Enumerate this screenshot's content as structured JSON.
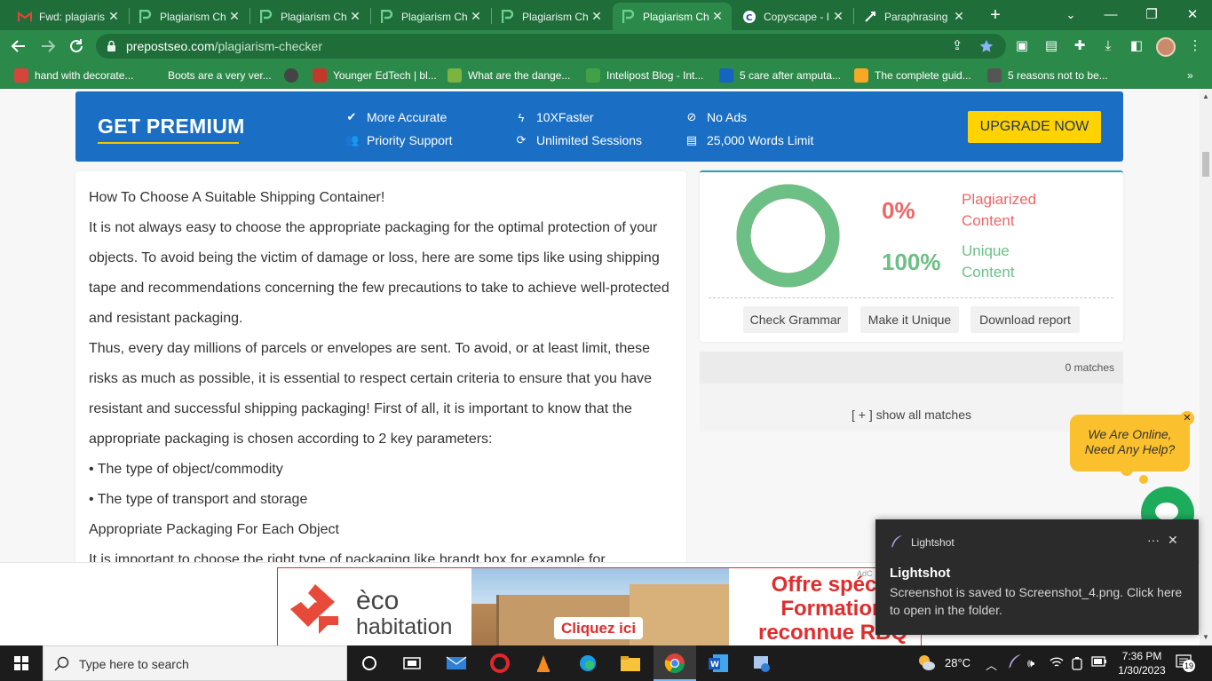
{
  "browser": {
    "tabs": [
      {
        "title": "Fwd: plagiaris",
        "icon": "gmail-icon",
        "active": false
      },
      {
        "title": "Plagiarism Ch",
        "icon": "prepostseo-icon",
        "active": false
      },
      {
        "title": "Plagiarism Ch",
        "icon": "prepostseo-icon",
        "active": false
      },
      {
        "title": "Plagiarism Ch",
        "icon": "prepostseo-icon",
        "active": false
      },
      {
        "title": "Plagiarism Ch",
        "icon": "prepostseo-icon",
        "active": false
      },
      {
        "title": "Plagiarism Ch",
        "icon": "prepostseo-icon",
        "active": true
      },
      {
        "title": "Copyscape - I",
        "icon": "copyscape-icon",
        "active": false
      },
      {
        "title": "Paraphrasing",
        "icon": "paraphrasing-icon",
        "active": false
      }
    ],
    "tab_close": "✕",
    "new_tab": "+",
    "window_controls": {
      "minimize": "—",
      "restore": "❐",
      "close": "✕",
      "tab_search": "⌄"
    },
    "url_domain": "prepostseo.com",
    "url_path": "/plagiarism-checker",
    "bookmarks": [
      {
        "label": "hand with decorate...",
        "icon_color": "#d6453b"
      },
      {
        "label": "Boots are a very ver...",
        "icon_color": "#2b8a4a"
      },
      {
        "label": "",
        "icon_color": "#444444"
      },
      {
        "label": "Younger EdTech | bl...",
        "icon_color": "#c0392b"
      },
      {
        "label": "What are the dange...",
        "icon_color": "#7cb342"
      },
      {
        "label": "Intelipost Blog - Int...",
        "icon_color": "#43a047"
      },
      {
        "label": "5 care after amputa...",
        "icon_color": "#1565c0"
      },
      {
        "label": "The complete guid...",
        "icon_color": "#f9a825"
      },
      {
        "label": "5 reasons not to be...",
        "icon_color": "#555555"
      }
    ],
    "bookmarks_overflow": "»"
  },
  "premium": {
    "title": "GET PREMIUM",
    "features": [
      {
        "label": "More Accurate",
        "icon": "check-circle-icon"
      },
      {
        "label": "Priority Support",
        "icon": "users-icon"
      },
      {
        "label": "10XFaster",
        "icon": "bolt-icon"
      },
      {
        "label": "Unlimited Sessions",
        "icon": "refresh-icon"
      },
      {
        "label": "No Ads",
        "icon": "ban-icon"
      },
      {
        "label": "25,000 Words Limit",
        "icon": "document-icon"
      }
    ],
    "upgrade_label": "UPGRADE NOW",
    "accent": "#ffd200",
    "background": "#1a6ec4"
  },
  "article": {
    "paragraphs": [
      "How To Choose A Suitable Shipping Container!",
      "It is not always easy to choose the appropriate packaging for the optimal protection of your objects. To avoid being the victim of damage or loss, here are some tips like using shipping tape and recommendations concerning the few precautions to take to achieve well-protected and resistant packaging.",
      "Thus, every day millions of parcels or envelopes are sent. To avoid, or at least limit, these risks as much as possible, it is essential to respect certain criteria to ensure that you have resistant and successful shipping packaging!  First of all, it is important to know that the appropriate packaging is chosen according to 2 key parameters:",
      "• The type of object/commodity",
      "• The type of transport and storage",
      "Appropriate Packaging For Each Object",
      "It is important to choose the right type of packaging like brandt box for example for"
    ]
  },
  "result": {
    "plagiarized_pct": "0%",
    "plagiarized_label_1": "Plagiarized",
    "plagiarized_label_2": "Content",
    "unique_pct": "100%",
    "unique_label_1": "Unique",
    "unique_label_2": "Content",
    "unique_fraction": 1.0,
    "plagiarized_color": "#ee6666",
    "unique_color": "#6cbf85",
    "actions": [
      "Check Grammar",
      "Make it Unique",
      "Download report"
    ],
    "matches_count": "0 matches",
    "show_all": "[ + ] show all matches"
  },
  "chat": {
    "line_1": "We Are Online,",
    "line_2": "Need Any Help?",
    "close": "✕",
    "color": "#fbc02d"
  },
  "ad": {
    "brand_1": "èco",
    "brand_2": "habitation",
    "cta": "Cliquez ici",
    "offer_1": "Offre spécia",
    "offer_2": "Formation",
    "offer_3": "reconnue RBQ",
    "tag": "AdC"
  },
  "toast": {
    "app": "Lightshot",
    "title": "Lightshot",
    "message": "Screenshot is saved to Screenshot_4.png. Click here to open in the folder.",
    "more": "···",
    "close": "✕"
  },
  "taskbar": {
    "search_placeholder": "Type here to search",
    "temperature": "28°C",
    "time": "7:36 PM",
    "date": "1/30/2023",
    "notification_count": "19"
  }
}
